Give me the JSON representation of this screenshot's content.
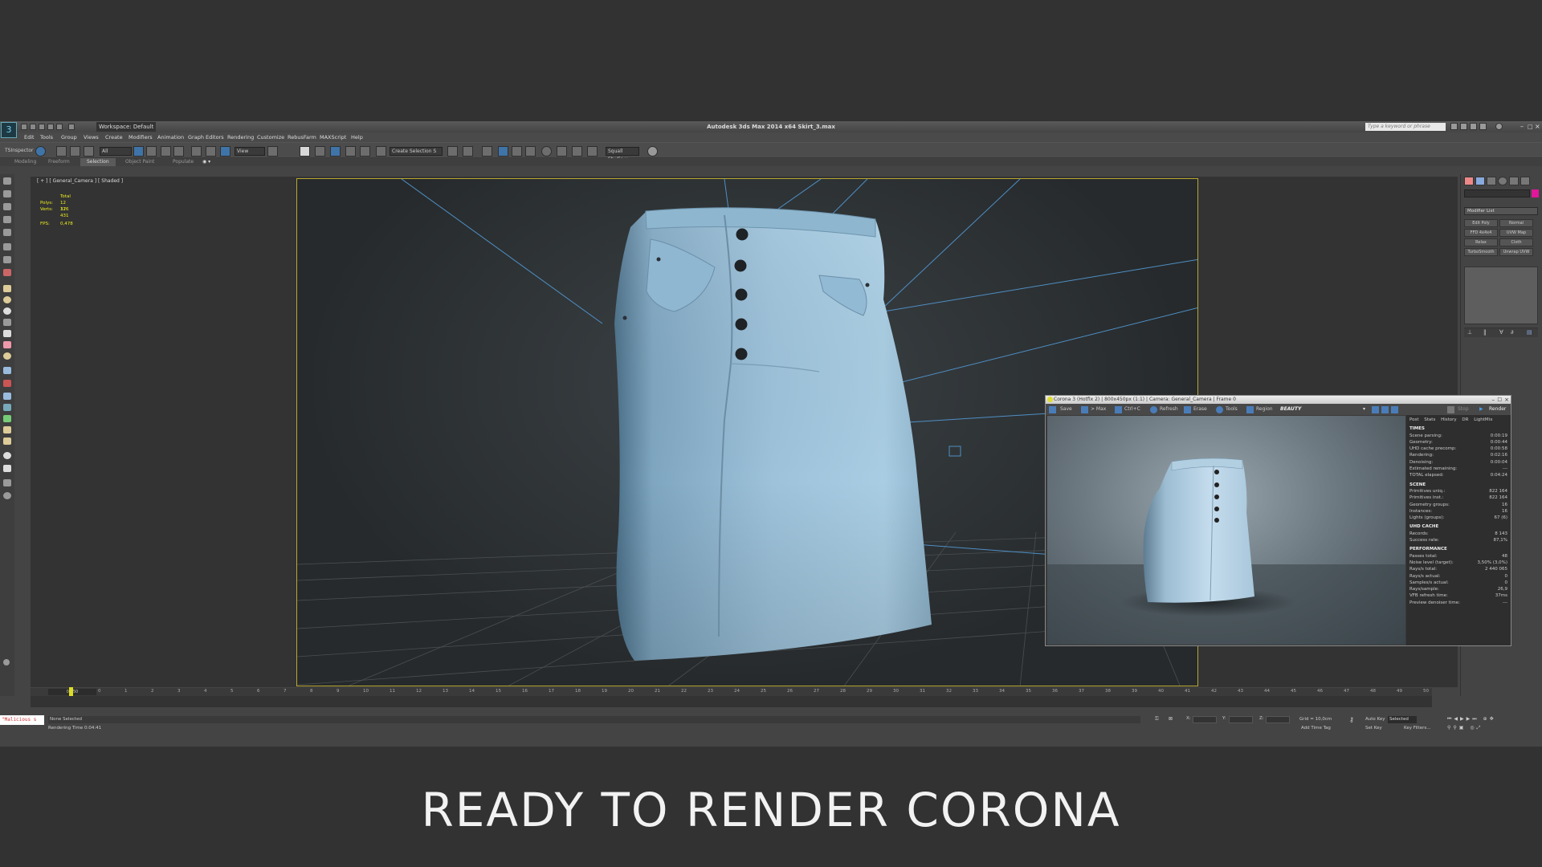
{
  "app": {
    "title": "Autodesk 3ds Max 2014 x64    Skirt_3.max",
    "workspace": "Workspace: Default",
    "search_placeholder": "Type a keyword or phrase"
  },
  "menu": [
    "Edit",
    "Tools",
    "Group",
    "Views",
    "Create",
    "Modifiers",
    "Animation",
    "Graph Editors",
    "Rendering",
    "Customize",
    "RebusFarm",
    "MAXScript",
    "Help"
  ],
  "toolbar": {
    "inspector_label": "TSInspector",
    "filter_value": "All",
    "refcoord_value": "View",
    "selection_set": "Create Selection S",
    "squall_label": "Squall Studio v"
  },
  "ribbon": {
    "tabs": [
      "Modeling",
      "Freeform",
      "Selection",
      "Object Paint",
      "Populate"
    ],
    "active": "Selection"
  },
  "viewport": {
    "label": "[ + ] [ General_Camera ] [ Shaded ]",
    "stats": {
      "total_label": "Total",
      "polys_label": "Polys:",
      "polys": "12 376",
      "verts_label": "Verts:",
      "verts": "12 431",
      "fps_label": "FPS:",
      "fps": "0,478"
    }
  },
  "command_panel": {
    "modifier_list": "Modifier List",
    "buttons": [
      "Edit Poly",
      "Normal",
      "FFD 4x4x4",
      "UVW Map",
      "Relax",
      "Cloth",
      "TurboSmooth",
      "Unwrap UVW"
    ]
  },
  "render_window": {
    "title": "Corona 3 (Hotfix 2) | 800x450px (1:1) | Camera: General_Camera | Frame 0",
    "toolbar": [
      "Save",
      "> Max",
      "Ctrl+C",
      "Refresh",
      "Erase",
      "Tools",
      "Region",
      "BEAUTY",
      "Stop",
      "Render"
    ],
    "tabs": [
      "Post",
      "Stats",
      "History",
      "DR",
      "LightMix"
    ],
    "sections": [
      {
        "title": "TIMES",
        "rows": [
          [
            "Scene parsing:",
            "0:00:19"
          ],
          [
            "Geometry:",
            "0:00:44"
          ],
          [
            "UHD cache precomp:",
            "0:00:58"
          ],
          [
            "Rendering:",
            "0:02:16"
          ],
          [
            "Denoising:",
            "0:00:04"
          ],
          [
            "Estimated remaining:",
            "---"
          ],
          [
            "TOTAL elapsed:",
            "0:04:24"
          ]
        ]
      },
      {
        "title": "SCENE",
        "rows": [
          [
            "Primitives uniq.:",
            "822 164"
          ],
          [
            "Primitives inst.:",
            "822 164"
          ],
          [
            "Geometry groups:",
            "16"
          ],
          [
            "Instances:",
            "16"
          ],
          [
            "Lights (groups):",
            "67 (6)"
          ]
        ]
      },
      {
        "title": "UHD CACHE",
        "rows": [
          [
            "Records:",
            "8 143"
          ],
          [
            "Success rate:",
            "87,1%"
          ]
        ]
      },
      {
        "title": "PERFORMANCE",
        "rows": [
          [
            "Passes total:",
            "48"
          ],
          [
            "Noise level (target):",
            "3,50% (3,0%)"
          ],
          [
            "Rays/s total:",
            "2 440 065"
          ],
          [
            "Rays/s actual:",
            "0"
          ],
          [
            "Samples/s actual:",
            "0"
          ],
          [
            "Rays/sample:",
            "26,9"
          ],
          [
            "VFB refresh time:",
            "37ms"
          ],
          [
            "Preview denoiser time:",
            "---"
          ]
        ]
      }
    ]
  },
  "timeline": {
    "frame_counter": "0 / 50",
    "frames": [
      "0",
      "1",
      "2",
      "3",
      "4",
      "5",
      "6",
      "7",
      "8",
      "9",
      "10",
      "11",
      "12",
      "13",
      "14",
      "15",
      "16",
      "17",
      "18",
      "19",
      "20",
      "21",
      "22",
      "23",
      "24",
      "25",
      "26",
      "27",
      "28",
      "29",
      "30",
      "31",
      "32",
      "33",
      "34",
      "35",
      "36",
      "37",
      "38",
      "39",
      "40",
      "41",
      "42",
      "43",
      "44",
      "45",
      "46",
      "47",
      "48",
      "49",
      "50"
    ]
  },
  "status": {
    "maxscript": "\"Malicious s",
    "selection": "None Selected",
    "render_time": "Rendering Time  0:04:41",
    "x_label": "X:",
    "y_label": "Y:",
    "z_label": "Z:",
    "grid": "Grid = 10,0cm",
    "auto_key": "Auto Key",
    "auto_key_value": "Selected",
    "set_key": "Set Key",
    "key_filters": "Key Filters...",
    "add_time_tag": "Add Time Tag"
  },
  "caption": "READY TO RENDER  CORONA",
  "colors": {
    "viewport_border": "#b9a830",
    "denim": "#7fb0cf",
    "caption": "#f2f2f2"
  }
}
